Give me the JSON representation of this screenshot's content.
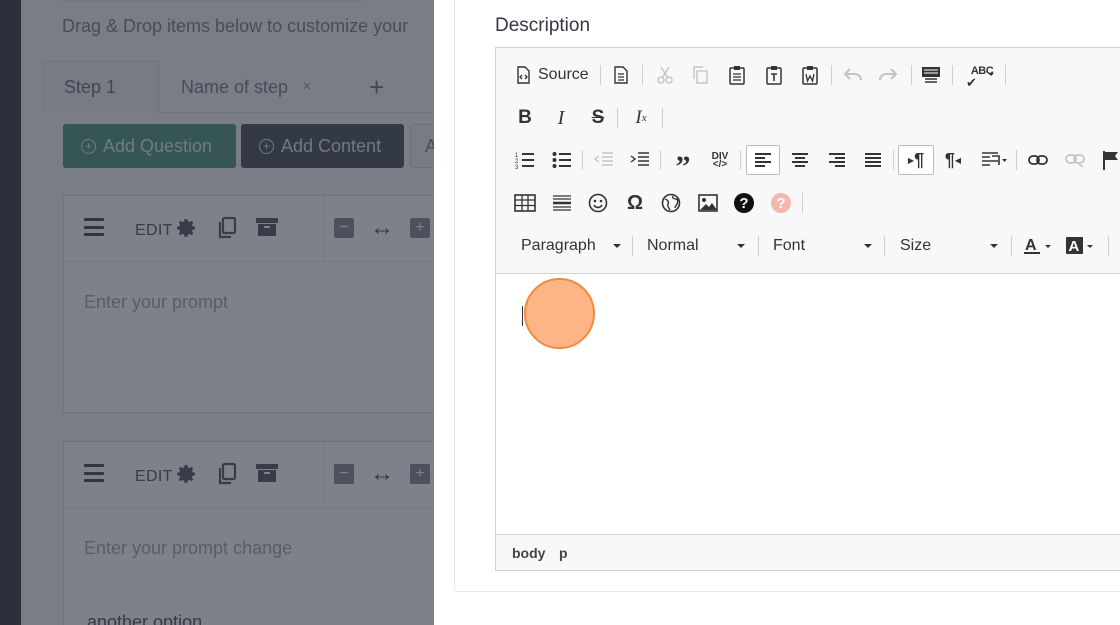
{
  "background": {
    "hint": "Drag & Drop items below to customize your",
    "tabs": [
      {
        "label": "Step 1"
      },
      {
        "label": "Name of step",
        "close": "×"
      }
    ],
    "add_tab": "+",
    "buttons": {
      "add_question": "Add Question",
      "add_content": "Add Content",
      "extra": "A"
    },
    "cards": [
      {
        "edit": "EDIT",
        "prompt": "Enter your prompt"
      },
      {
        "edit": "EDIT",
        "prompt": "Enter your prompt change"
      }
    ],
    "bottom_text": "another option"
  },
  "panel": {
    "description_label": "Description",
    "toolbar": {
      "source_label": "Source",
      "format_combo": "Paragraph",
      "style_combo": "Normal",
      "font_combo": "Font",
      "size_combo": "Size",
      "div_label": "DIV",
      "abc_label": "ABC"
    },
    "statusbar": [
      "body",
      "p"
    ]
  },
  "colors": {
    "add_question_bg": "#3f8f78",
    "add_content_bg": "#3d4350",
    "click_marker": "#f08a3c"
  }
}
